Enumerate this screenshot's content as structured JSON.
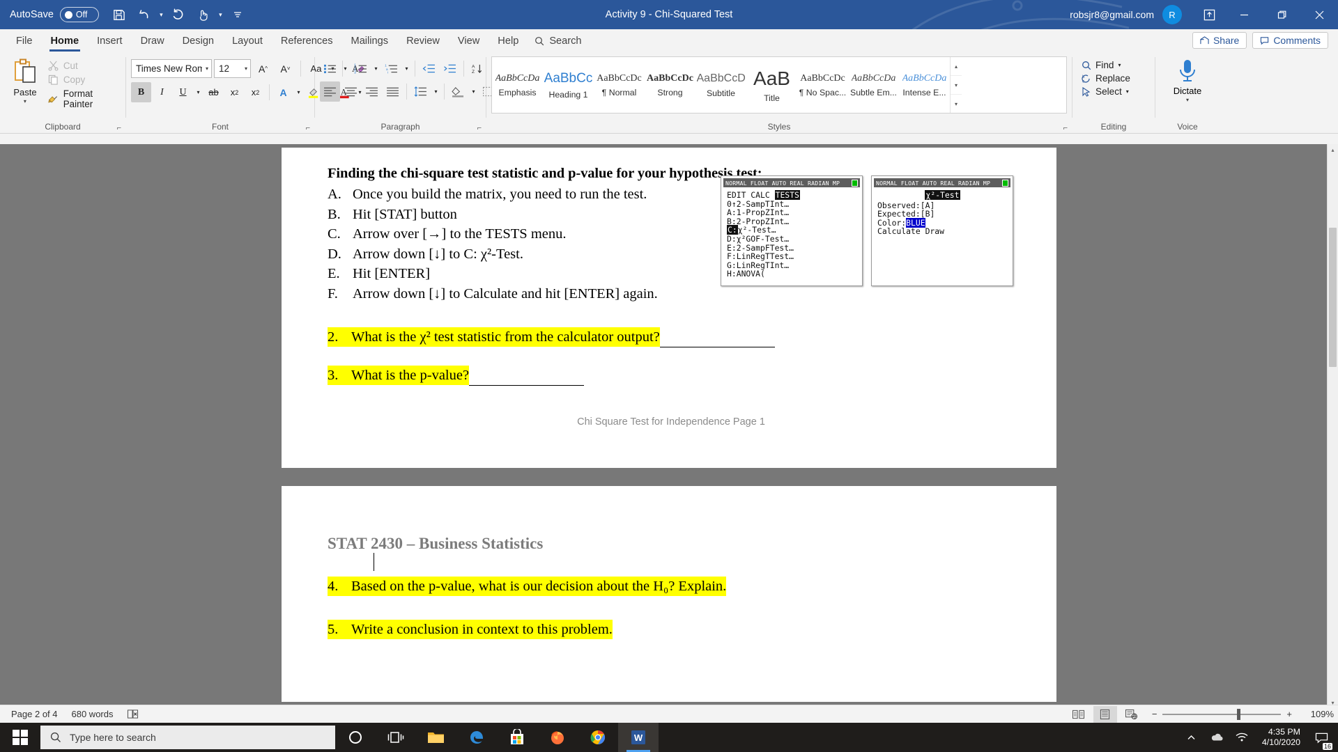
{
  "titlebar": {
    "autosave_label": "AutoSave",
    "autosave_state": "Off",
    "doc_title": "Activity 9 - Chi-Squared Test",
    "account": "robsjr8@gmail.com",
    "avatar_initial": "R",
    "bg": "#2b579a",
    "qat": [
      "save-icon",
      "undo-icon",
      "redo-icon",
      "touch-mode-icon",
      "customize-qat-icon"
    ]
  },
  "tabs": [
    {
      "label": "File",
      "active": false
    },
    {
      "label": "Home",
      "active": true
    },
    {
      "label": "Insert",
      "active": false
    },
    {
      "label": "Draw",
      "active": false
    },
    {
      "label": "Design",
      "active": false
    },
    {
      "label": "Layout",
      "active": false
    },
    {
      "label": "References",
      "active": false
    },
    {
      "label": "Mailings",
      "active": false
    },
    {
      "label": "Review",
      "active": false
    },
    {
      "label": "View",
      "active": false
    },
    {
      "label": "Help",
      "active": false
    }
  ],
  "search": {
    "label": "Search"
  },
  "tab_actions": [
    {
      "label": "Share",
      "icon": "share-icon"
    },
    {
      "label": "Comments",
      "icon": "comment-icon"
    }
  ],
  "ribbon": {
    "clipboard": {
      "group_label": "Clipboard",
      "paste_label": "Paste",
      "items": [
        {
          "label": "Cut",
          "enabled": false
        },
        {
          "label": "Copy",
          "enabled": false
        },
        {
          "label": "Format Painter",
          "enabled": true
        }
      ]
    },
    "font": {
      "group_label": "Font",
      "font_name": "Times New Roman",
      "font_size": "12",
      "bold_active": true
    },
    "paragraph": {
      "group_label": "Paragraph"
    },
    "styles": {
      "group_label": "Styles",
      "items": [
        {
          "preview": "AaBbCcDa",
          "name": "Emphasis"
        },
        {
          "preview": "AaBbCc",
          "name": "Heading 1"
        },
        {
          "preview": "AaBbCcDc",
          "name": "¶ Normal"
        },
        {
          "preview": "AaBbCcDc",
          "name": "Strong"
        },
        {
          "preview": "AaBbCcD",
          "name": "Subtitle"
        },
        {
          "preview": "AaB",
          "name": "Title"
        },
        {
          "preview": "AaBbCcDc",
          "name": "¶ No Spac..."
        },
        {
          "preview": "AaBbCcDa",
          "name": "Subtle Em..."
        },
        {
          "preview": "AaBbCcDa",
          "name": "Intense E..."
        }
      ]
    },
    "editing": {
      "group_label": "Editing",
      "items": [
        {
          "label": "Find",
          "icon": "search-icon"
        },
        {
          "label": "Replace",
          "icon": "replace-icon"
        },
        {
          "label": "Select",
          "icon": "cursor-icon"
        }
      ]
    },
    "voice": {
      "group_label": "Voice",
      "dictate_label": "Dictate"
    }
  },
  "document": {
    "page1": {
      "heading": "Finding the chi-square test statistic and p-value for your hypothesis test:",
      "steps": [
        {
          "marker": "A.",
          "text": "Once you build the matrix, you need to run the test."
        },
        {
          "marker": "B.",
          "text": "Hit [STAT] button"
        },
        {
          "marker": "C.",
          "text": "Arrow over [→] to the TESTS menu."
        },
        {
          "marker": "D.",
          "text": "Arrow down [↓] to C: χ²-Test."
        },
        {
          "marker": "E.",
          "text": "Hit [ENTER]"
        },
        {
          "marker": "F.",
          "text": "Arrow down [↓] to Calculate and hit [ENTER] again."
        }
      ],
      "questions": [
        {
          "num": "2.",
          "text": "What is the χ² test statistic from the calculator output?",
          "blank_width": 136
        },
        {
          "num": "3.",
          "text": "What is the p-value?",
          "blank_width": 136
        }
      ],
      "footer": "Chi Square Test for Independence Page 1"
    },
    "page2": {
      "title": "STAT 2430 – Business Statistics",
      "questions": [
        {
          "num": "4.",
          "text": "Based on the p-value, what is our decision about the H₀? Explain."
        },
        {
          "num": "5.",
          "text": "Write a conclusion in context to this problem."
        }
      ]
    },
    "calculator_left": {
      "statusbar": "NORMAL FLOAT AUTO REAL RADIAN MP",
      "menu_tabs": [
        "EDIT",
        "CALC",
        "TESTS"
      ],
      "selected_tab": "TESTS",
      "lines": [
        "0↑2-SampTInt…",
        "A:1-PropZInt…",
        "B:2-PropZInt…",
        "C:χ²-Test…",
        "D:χ²GOF-Test…",
        "E:2-SampFTest…",
        "F:LinRegTTest…",
        "G:LinRegTInt…",
        "H:ANOVA("
      ],
      "selected_line": "C:"
    },
    "calculator_right": {
      "statusbar": "NORMAL FLOAT AUTO REAL RADIAN MP",
      "title": "χ²-Test",
      "fields": [
        {
          "label": "Observed:",
          "value": "[A]"
        },
        {
          "label": "Expected:",
          "value": "[B]"
        },
        {
          "label": "Color:",
          "value": "BLUE",
          "highlighted": true
        }
      ],
      "actions": "Calculate Draw"
    }
  },
  "statusbar": {
    "page_indicator": "Page 2 of 4",
    "word_count": "680 words",
    "proofing_icon": "proofing-errors-icon",
    "views": [
      {
        "name": "read-mode-icon",
        "active": false
      },
      {
        "name": "print-layout-icon",
        "active": true
      },
      {
        "name": "web-layout-icon",
        "active": false
      }
    ],
    "zoom_out": "−",
    "zoom_in": "+",
    "zoom_level": "109%"
  },
  "taskbar": {
    "search_placeholder": "Type here to search",
    "items": [
      {
        "name": "cortana-icon"
      },
      {
        "name": "task-view-icon"
      },
      {
        "name": "file-explorer-icon"
      },
      {
        "name": "edge-icon"
      },
      {
        "name": "microsoft-store-icon"
      },
      {
        "name": "firefox-icon"
      },
      {
        "name": "chrome-icon"
      },
      {
        "name": "word-icon"
      }
    ],
    "time": "4:35 PM",
    "date": "4/10/2020",
    "notification_count": "16"
  }
}
